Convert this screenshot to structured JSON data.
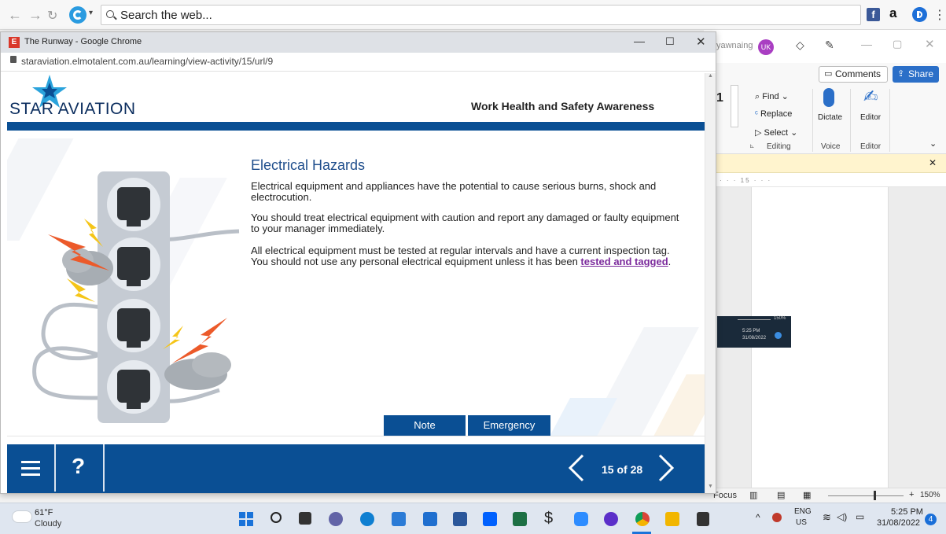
{
  "outer_browser": {
    "search_placeholder": "Search the web...",
    "right_icons": [
      "facebook-icon",
      "amazon-icon",
      "profile-icon"
    ],
    "amazon_label": "a"
  },
  "chrome_window": {
    "title": "The Runway - Google Chrome",
    "favicon_letter": "E",
    "url": "staraviation.elmotalent.com.au/learning/view-activity/15/url/9",
    "controls": [
      "minimize",
      "maximize",
      "close"
    ]
  },
  "course": {
    "logo_text": "STAR AVIATION",
    "header_title": "Work Health and Safety Awareness",
    "section_title": "Electrical Hazards",
    "paragraphs": {
      "p1": "Electrical equipment and appliances have the potential to cause serious burns, shock and electrocution.",
      "p2": "You should treat electrical equipment with caution and report any damaged or faulty equipment to your manager immediately.",
      "p3_before": "All electrical equipment must be tested at regular intervals and have a current inspection tag. You should not use any personal electrical equipment unless it has been ",
      "p3_link": "tested and tagged",
      "p3_after": "."
    },
    "buttons": {
      "note": "Note",
      "emergency": "Emergency"
    },
    "pager": "15 of 28",
    "colors": {
      "brand_blue": "#0a4f94",
      "link_purple": "#7b2a9c",
      "title_blue": "#1f4e8c"
    }
  },
  "word_app": {
    "user_fragment": "yawnaing",
    "avatar_initials": "UK",
    "comments": "Comments",
    "share": "Share",
    "find": "Find",
    "replace": "Replace",
    "select": "Select",
    "editing_group": "Editing",
    "dictate": "Dictate",
    "voice_group": "Voice",
    "editor": "Editor",
    "editor_group": "Editor",
    "font_size_fragment": "1",
    "ruler_text": "· · · 15 · · ·",
    "zoom_small": "150%",
    "mini_time": "5:25 PM",
    "mini_date": "31/08/2022",
    "status_focus": "Focus",
    "zoom": "150%"
  },
  "taskbar": {
    "weather_temp": "61°F",
    "weather_desc": "Cloudy",
    "lang_top": "ENG",
    "lang_bottom": "US",
    "time": "5:25 PM",
    "date": "31/08/2022",
    "notifications": "4"
  }
}
